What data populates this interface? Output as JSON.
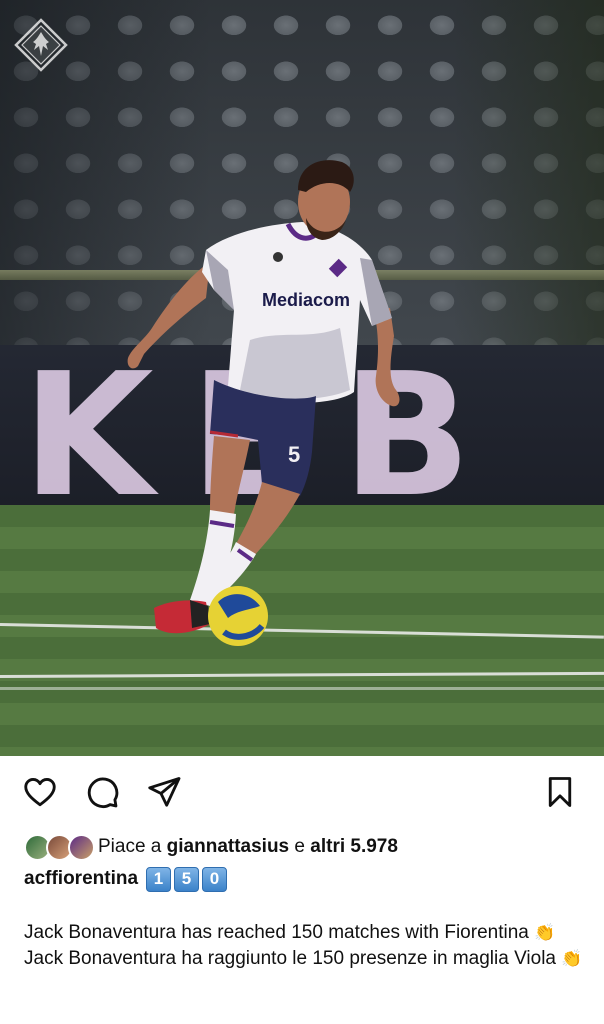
{
  "post": {
    "board_text": "KEB",
    "shirt_sponsor": "Mediacom",
    "shirt_number": "5"
  },
  "actions": {
    "like_icon": "heart-icon",
    "comment_icon": "comment-icon",
    "share_icon": "send-icon",
    "save_icon": "bookmark-icon"
  },
  "likes": {
    "prefix": "Piace a ",
    "user": "giannattasius",
    "middle": " e ",
    "others": "altri 5.978"
  },
  "caption": {
    "username": "acffiorentina",
    "keycaps": [
      "1",
      "5",
      "0"
    ],
    "line1": "Jack Bonaventura has reached 150 matches with Fiorentina",
    "line2": "Jack Bonaventura ha raggiunto le 150 presenze in maglia Viola",
    "emoji": "👏"
  },
  "colors": {
    "viola": "#5b2a86",
    "text": "#111111",
    "keycap": "#3b82c9"
  }
}
